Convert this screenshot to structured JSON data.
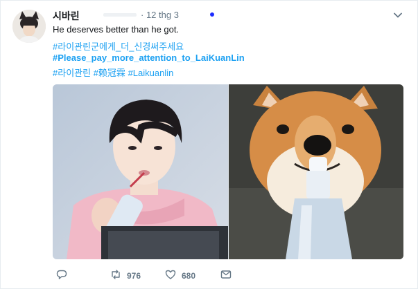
{
  "tweet": {
    "author_name": "시바린",
    "date": "· 12 thg 3",
    "text": "He deserves better than he got.",
    "hashtag_line_1": "#라이관린군에게_더_신경써주세요",
    "hashtag_line_2": "#Please_pay_more_attention_to_LaiKuanLin",
    "hashtags_line_3": [
      "#라이관린",
      "#赖冠霖",
      "#Laikuanlin"
    ]
  },
  "actions": {
    "retweets": "976",
    "likes": "680"
  },
  "colors": {
    "link": "#1da1f2",
    "muted": "#657786",
    "unread_dot": "#1d2dff"
  },
  "icons": [
    "reply-icon",
    "retweet-icon",
    "like-icon",
    "dm-icon",
    "chevron-down-icon"
  ]
}
